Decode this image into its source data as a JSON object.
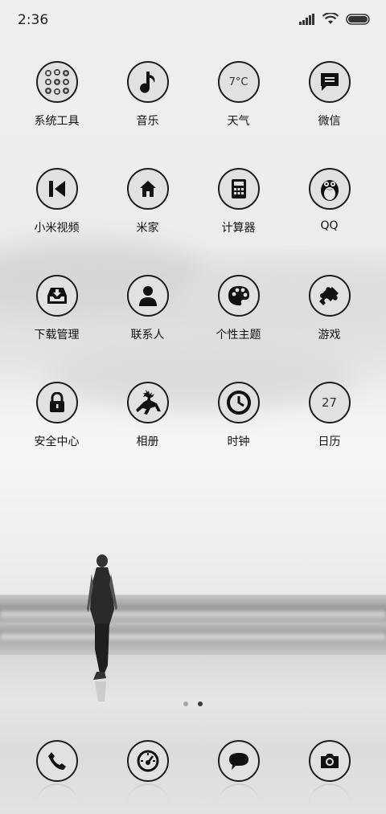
{
  "status_bar": {
    "time": "2:36"
  },
  "apps": [
    {
      "id": "system-tools",
      "label": "系统工具",
      "icon": "folder-icon"
    },
    {
      "id": "music",
      "label": "音乐",
      "icon": "music-note-icon"
    },
    {
      "id": "weather",
      "label": "天气",
      "icon": "weather-icon",
      "icon_text": "7°C"
    },
    {
      "id": "wechat",
      "label": "微信",
      "icon": "chat-bubble-icon"
    },
    {
      "id": "mi-video",
      "label": "小米视频",
      "icon": "skip-back-icon"
    },
    {
      "id": "mi-home",
      "label": "米家",
      "icon": "home-icon"
    },
    {
      "id": "calculator",
      "label": "计算器",
      "icon": "calculator-icon"
    },
    {
      "id": "qq",
      "label": "QQ",
      "icon": "penguin-icon"
    },
    {
      "id": "downloads",
      "label": "下载管理",
      "icon": "download-tray-icon"
    },
    {
      "id": "contacts",
      "label": "联系人",
      "icon": "person-icon"
    },
    {
      "id": "themes",
      "label": "个性主题",
      "icon": "palette-icon"
    },
    {
      "id": "games",
      "label": "游戏",
      "icon": "puzzle-icon"
    },
    {
      "id": "security",
      "label": "安全中心",
      "icon": "lock-icon"
    },
    {
      "id": "gallery",
      "label": "相册",
      "icon": "deer-icon"
    },
    {
      "id": "clock",
      "label": "时钟",
      "icon": "clock-icon"
    },
    {
      "id": "calendar",
      "label": "日历",
      "icon": "calendar-icon",
      "icon_text": "27"
    }
  ],
  "page_indicator": {
    "pages": 2,
    "current": 2
  },
  "dock": [
    {
      "id": "phone",
      "icon": "phone-icon"
    },
    {
      "id": "browser",
      "icon": "speedometer-icon"
    },
    {
      "id": "messages",
      "icon": "message-icon"
    },
    {
      "id": "camera",
      "icon": "camera-icon"
    }
  ]
}
